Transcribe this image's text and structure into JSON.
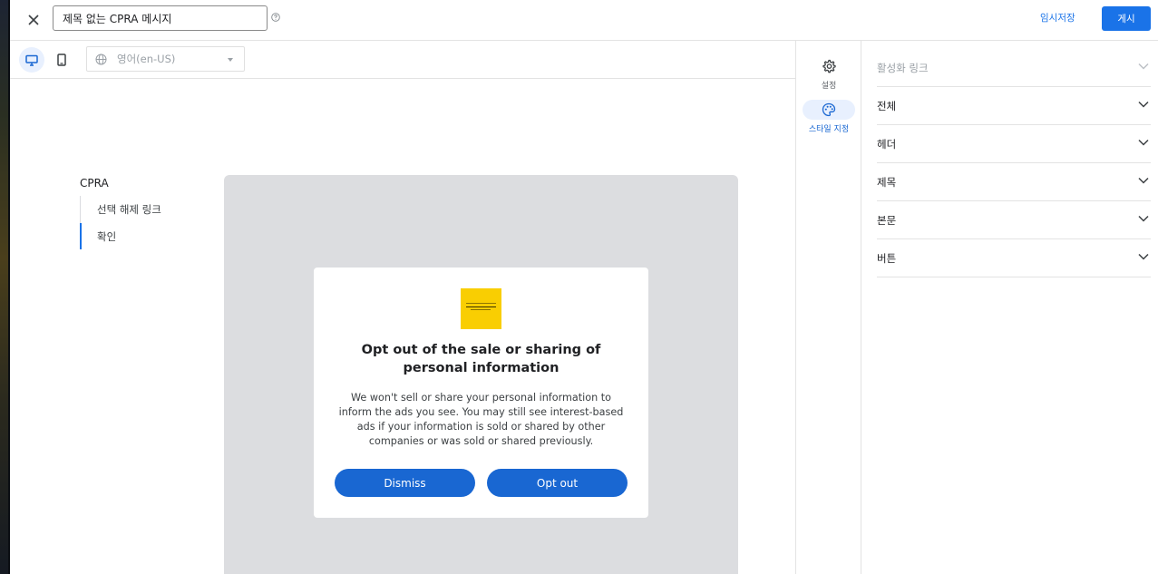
{
  "header": {
    "title_value": "제목 없는 CPRA 메시지",
    "draft_label": "임시저장",
    "publish_label": "게시"
  },
  "toolbar": {
    "language_label": "영어(en-US)"
  },
  "nav": {
    "title": "CPRA",
    "items": [
      {
        "label": "선택 해제 링크"
      },
      {
        "label": "확인"
      }
    ]
  },
  "dialog": {
    "title": "Opt out of the sale or sharing of personal information",
    "body": "We won't sell or share your personal information to inform the ads you see. You may still see interest-based ads if your information is sold or shared by other companies or was sold or shared previously.",
    "dismiss_label": "Dismiss",
    "optout_label": "Opt out",
    "button_color": "#1967d2",
    "logo_color": "#f9ce02"
  },
  "rail": {
    "items": [
      {
        "label": "설정",
        "icon": "gear-icon"
      },
      {
        "label": "스타일 지정",
        "icon": "palette-icon"
      }
    ]
  },
  "style_panel": {
    "sections": [
      {
        "label": "활성화 링크",
        "disabled": true
      },
      {
        "label": "전체"
      },
      {
        "label": "헤더"
      },
      {
        "label": "제목"
      },
      {
        "label": "본문"
      },
      {
        "label": "버튼"
      }
    ]
  },
  "colors": {
    "accent": "#1a73e8"
  }
}
